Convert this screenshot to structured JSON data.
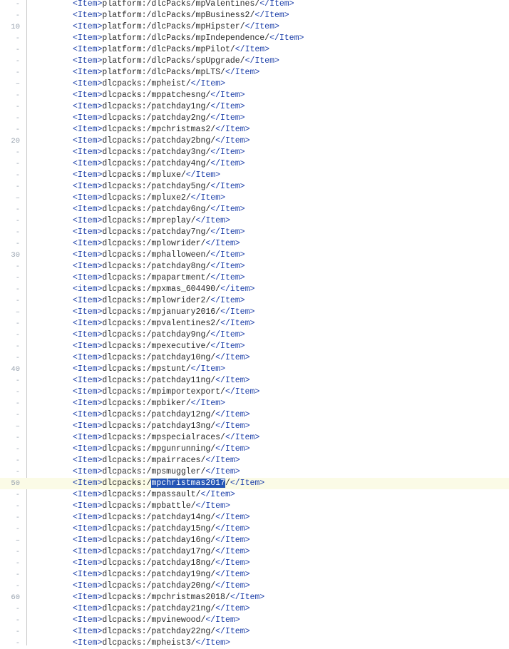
{
  "editor": {
    "current_line": 50,
    "selection": {
      "line": 50,
      "text": "mpchristmas2017"
    },
    "lines": [
      {
        "num": "-",
        "tag": "Item",
        "path": "platform:/dlcPacks/mpValentines/"
      },
      {
        "num": "-",
        "tag": "Item",
        "path": "platform:/dlcPacks/mpBusiness2/"
      },
      {
        "num": "10",
        "tag": "Item",
        "path": "platform:/dlcPacks/mpHipster/"
      },
      {
        "num": "-",
        "tag": "Item",
        "path": "platform:/dlcPacks/mpIndependence/"
      },
      {
        "num": "-",
        "tag": "Item",
        "path": "platform:/dlcPacks/mpPilot/"
      },
      {
        "num": "-",
        "tag": "Item",
        "path": "platform:/dlcPacks/spUpgrade/"
      },
      {
        "num": "-",
        "tag": "Item",
        "path": "platform:/dlcPacks/mpLTS/"
      },
      {
        "num": "–",
        "tag": "Item",
        "path": "dlcpacks:/mpheist/"
      },
      {
        "num": "-",
        "tag": "Item",
        "path": "dlcpacks:/mppatchesng/"
      },
      {
        "num": "-",
        "tag": "Item",
        "path": "dlcpacks:/patchday1ng/"
      },
      {
        "num": "-",
        "tag": "Item",
        "path": "dlcpacks:/patchday2ng/"
      },
      {
        "num": "-",
        "tag": "Item",
        "path": "dlcpacks:/mpchristmas2/"
      },
      {
        "num": "20",
        "tag": "Item",
        "path": "dlcpacks:/patchday2bng/"
      },
      {
        "num": "-",
        "tag": "Item",
        "path": "dlcpacks:/patchday3ng/"
      },
      {
        "num": "-",
        "tag": "Item",
        "path": "dlcpacks:/patchday4ng/"
      },
      {
        "num": "-",
        "tag": "Item",
        "path": "dlcpacks:/mpluxe/"
      },
      {
        "num": "-",
        "tag": "Item",
        "path": "dlcpacks:/patchday5ng/"
      },
      {
        "num": "–",
        "tag": "Item",
        "path": "dlcpacks:/mpluxe2/"
      },
      {
        "num": "-",
        "tag": "Item",
        "path": "dlcpacks:/patchday6ng/"
      },
      {
        "num": "-",
        "tag": "Item",
        "path": "dlcpacks:/mpreplay/"
      },
      {
        "num": "-",
        "tag": "Item",
        "path": "dlcpacks:/patchday7ng/"
      },
      {
        "num": "-",
        "tag": "Item",
        "path": "dlcpacks:/mplowrider/"
      },
      {
        "num": "30",
        "tag": "Item",
        "path": "dlcpacks:/mphalloween/"
      },
      {
        "num": "-",
        "tag": "Item",
        "path": "dlcpacks:/patchday8ng/"
      },
      {
        "num": "-",
        "tag": "Item",
        "path": "dlcpacks:/mpapartment/"
      },
      {
        "num": "-",
        "tag": "item",
        "path": "dlcpacks:/mpxmas_604490/"
      },
      {
        "num": "-",
        "tag": "Item",
        "path": "dlcpacks:/mplowrider2/"
      },
      {
        "num": "–",
        "tag": "Item",
        "path": "dlcpacks:/mpjanuary2016/"
      },
      {
        "num": "-",
        "tag": "Item",
        "path": "dlcpacks:/mpvalentines2/"
      },
      {
        "num": "-",
        "tag": "Item",
        "path": "dlcpacks:/patchday9ng/"
      },
      {
        "num": "-",
        "tag": "Item",
        "path": "dlcpacks:/mpexecutive/"
      },
      {
        "num": "-",
        "tag": "Item",
        "path": "dlcpacks:/patchday10ng/"
      },
      {
        "num": "40",
        "tag": "Item",
        "path": "dlcpacks:/mpstunt/"
      },
      {
        "num": "-",
        "tag": "Item",
        "path": "dlcpacks:/patchday11ng/"
      },
      {
        "num": "-",
        "tag": "Item",
        "path": "dlcpacks:/mpimportexport/"
      },
      {
        "num": "-",
        "tag": "Item",
        "path": "dlcpacks:/mpbiker/"
      },
      {
        "num": "-",
        "tag": "Item",
        "path": "dlcpacks:/patchday12ng/"
      },
      {
        "num": "–",
        "tag": "Item",
        "path": "dlcpacks:/patchday13ng/"
      },
      {
        "num": "-",
        "tag": "Item",
        "path": "dlcpacks:/mpspecialraces/"
      },
      {
        "num": "-",
        "tag": "Item",
        "path": "dlcpacks:/mpgunrunning/"
      },
      {
        "num": "-",
        "tag": "Item",
        "path": "dlcpacks:/mpairraces/"
      },
      {
        "num": "-",
        "tag": "Item",
        "path": "dlcpacks:/mpsmuggler/"
      },
      {
        "num": "50",
        "tag": "Item",
        "path": "dlcpacks:/mpchristmas2017/"
      },
      {
        "num": "-",
        "tag": "Item",
        "path": "dlcpacks:/mpassault/"
      },
      {
        "num": "-",
        "tag": "Item",
        "path": "dlcpacks:/mpbattle/"
      },
      {
        "num": "-",
        "tag": "Item",
        "path": "dlcpacks:/patchday14ng/"
      },
      {
        "num": "-",
        "tag": "Item",
        "path": "dlcpacks:/patchday15ng/"
      },
      {
        "num": "–",
        "tag": "Item",
        "path": "dlcpacks:/patchday16ng/"
      },
      {
        "num": "-",
        "tag": "Item",
        "path": "dlcpacks:/patchday17ng/"
      },
      {
        "num": "-",
        "tag": "Item",
        "path": "dlcpacks:/patchday18ng/"
      },
      {
        "num": "-",
        "tag": "Item",
        "path": "dlcpacks:/patchday19ng/"
      },
      {
        "num": "-",
        "tag": "Item",
        "path": "dlcpacks:/patchday20ng/"
      },
      {
        "num": "60",
        "tag": "Item",
        "path": "dlcpacks:/mpchristmas2018/"
      },
      {
        "num": "-",
        "tag": "Item",
        "path": "dlcpacks:/patchday21ng/"
      },
      {
        "num": "-",
        "tag": "Item",
        "path": "dlcpacks:/mpvinewood/"
      },
      {
        "num": "-",
        "tag": "Item",
        "path": "dlcpacks:/patchday22ng/"
      },
      {
        "num": "-",
        "tag": "Item",
        "path": "dlcpacks:/mpheist3/"
      }
    ]
  }
}
